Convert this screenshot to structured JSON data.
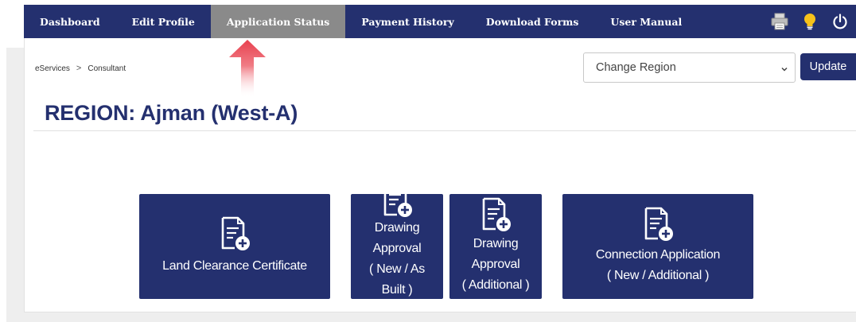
{
  "nav": {
    "items": [
      {
        "label": "Dashboard",
        "active": false
      },
      {
        "label": "Edit Profile",
        "active": false
      },
      {
        "label": "Application Status",
        "active": true
      },
      {
        "label": "Payment History",
        "active": false
      },
      {
        "label": "Download Forms",
        "active": false
      },
      {
        "label": "User Manual",
        "active": false
      }
    ],
    "icons": [
      "printer-icon",
      "lightbulb-icon",
      "power-icon"
    ]
  },
  "breadcrumb": {
    "items": [
      "eServices",
      "Consultant"
    ],
    "separator": ">"
  },
  "region_select": {
    "selected": "Change Region",
    "update_label": "Update"
  },
  "region_title": "REGION: Ajman (West-A)",
  "tiles": [
    {
      "lines": [
        "Land Clearance Certificate"
      ],
      "icon": "document-add-icon"
    },
    {
      "lines": [
        "Drawing",
        "Approval",
        "( New / As",
        "Built )"
      ],
      "icon": "document-add-icon"
    },
    {
      "lines": [
        "Drawing",
        "Approval",
        "( Additional )"
      ],
      "icon": "document-add-icon"
    },
    {
      "lines": [
        "Connection Application",
        "( New / Additional )"
      ],
      "icon": "document-add-icon"
    }
  ],
  "colors": {
    "brand_navy": "#24306f",
    "active_tab": "#8a8a8a",
    "title_text": "#24306f",
    "lightbulb": "#f7c21a",
    "annotation_arrow": "#e8414f"
  }
}
